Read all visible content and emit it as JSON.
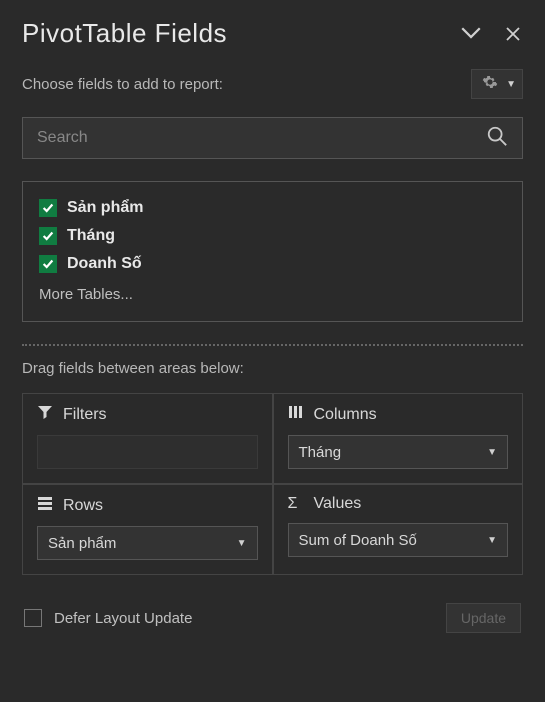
{
  "title": "PivotTable Fields",
  "chooseLabel": "Choose fields to add to report:",
  "search": {
    "placeholder": "Search"
  },
  "fields": [
    {
      "label": "Sản phẩm",
      "checked": true
    },
    {
      "label": "Tháng",
      "checked": true
    },
    {
      "label": "Doanh Số",
      "checked": true
    }
  ],
  "moreTables": "More Tables...",
  "dragLabel": "Drag fields between areas below:",
  "areas": {
    "filters": {
      "heading": "Filters",
      "item": ""
    },
    "columns": {
      "heading": "Columns",
      "item": "Tháng"
    },
    "rows": {
      "heading": "Rows",
      "item": "Sản phẩm"
    },
    "values": {
      "heading": "Values",
      "item": "Sum of Doanh Số"
    }
  },
  "deferLabel": "Defer Layout Update",
  "updateLabel": "Update"
}
